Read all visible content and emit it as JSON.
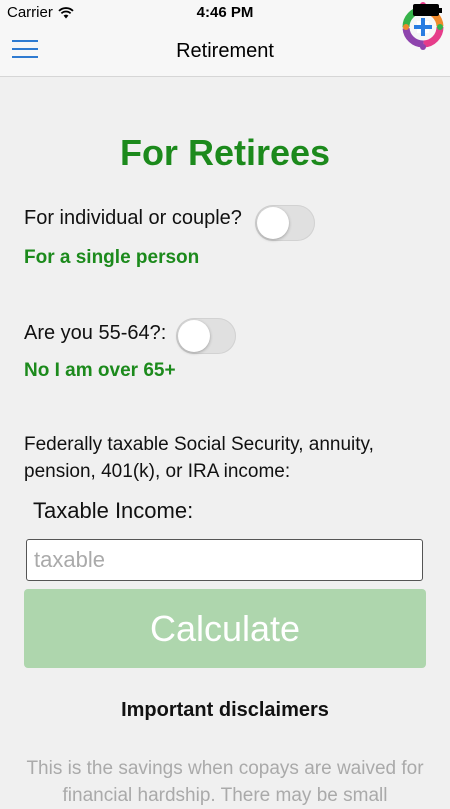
{
  "status_bar": {
    "carrier": "Carrier",
    "time": "4:46 PM"
  },
  "nav": {
    "title": "Retirement"
  },
  "main": {
    "heading": "For Retirees",
    "couple_question": "For individual or couple?",
    "couple_toggle_on": false,
    "couple_status": "For a single person",
    "age_question": "Are you 55-64?:",
    "age_toggle_on": false,
    "age_status": "No I am over 65+",
    "income_info": "Federally taxable Social Security, annuity, pension, 401(k), or IRA income:",
    "income_label": "Taxable Income:",
    "income_placeholder": "taxable",
    "income_value": "",
    "calculate_label": "Calculate",
    "disclaimer_heading": "Important disclaimers",
    "disclaimer_text": "This is the savings when copays are waived for financial hardship. There may be small"
  },
  "colors": {
    "heading_green": "#1c8a1c",
    "button_green_disabled": "#aed6ad",
    "nav_blue": "#2f7bd1"
  },
  "icons": {
    "menu": "hamburger-menu-icon",
    "wifi": "wifi-icon",
    "logo": "app-logo"
  }
}
